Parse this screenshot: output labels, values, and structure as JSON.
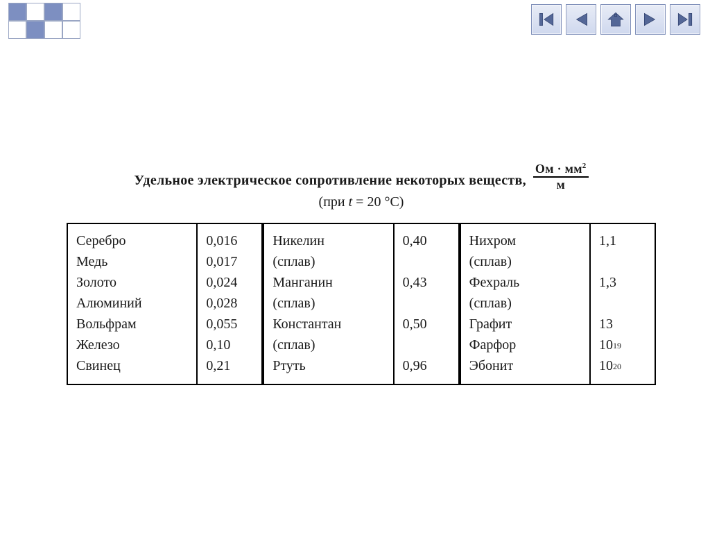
{
  "title": {
    "main": "Удельное электрическое сопротивление некоторых веществ,",
    "unit_numer": "Ом · мм",
    "unit_numer_sup": "2",
    "unit_denom": "м",
    "condition_prefix": "(при ",
    "condition_var": "t",
    "condition_eq": " = 20 °C)"
  },
  "blocks": [
    {
      "rows": [
        {
          "name": "Серебро",
          "value": "0,016"
        },
        {
          "name": "Медь",
          "value": "0,017"
        },
        {
          "name": "Золото",
          "value": "0,024"
        },
        {
          "name": "Алюминий",
          "value": "0,028"
        },
        {
          "name": "Вольфрам",
          "value": "0,055"
        },
        {
          "name": "Железо",
          "value": "0,10"
        },
        {
          "name": "Свинец",
          "value": "0,21"
        }
      ]
    },
    {
      "rows": [
        {
          "name": "Никелин",
          "value": "0,40"
        },
        {
          "name": "(сплав)",
          "value": ""
        },
        {
          "name": "Манганин",
          "value": "0,43"
        },
        {
          "name": "(сплав)",
          "value": ""
        },
        {
          "name": "Константан",
          "value": "0,50"
        },
        {
          "name": "(сплав)",
          "value": ""
        },
        {
          "name": "Ртуть",
          "value": "0,96"
        }
      ]
    },
    {
      "rows": [
        {
          "name": "Нихром",
          "value": "1,1"
        },
        {
          "name": "(сплав)",
          "value": ""
        },
        {
          "name": "Фехраль",
          "value": "1,3"
        },
        {
          "name": "(сплав)",
          "value": ""
        },
        {
          "name": "Графит",
          "value": "13"
        },
        {
          "name": "Фарфор",
          "value": "10",
          "exp": "19"
        },
        {
          "name": "Эбонит",
          "value": "10",
          "exp": "20"
        }
      ]
    }
  ],
  "checker_fill": "#7d8fc1",
  "checker_hollow": "#ffffff"
}
